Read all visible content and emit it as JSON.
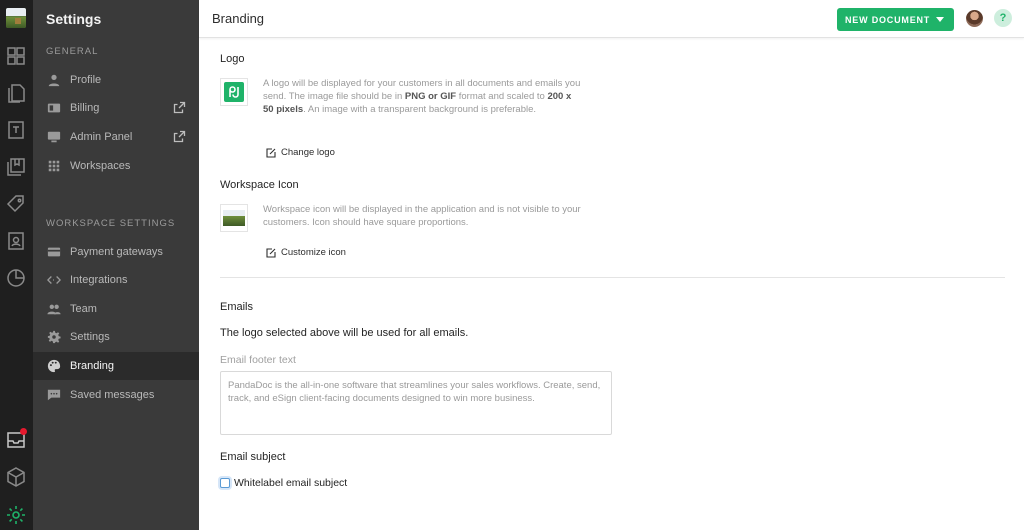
{
  "sidebar": {
    "title": "Settings",
    "general_heading": "GENERAL",
    "workspace_heading": "WORKSPACE SETTINGS",
    "general_items": [
      {
        "label": "Profile",
        "icon": "person-icon"
      },
      {
        "label": "Billing",
        "icon": "billing-icon"
      },
      {
        "label": "Admin Panel",
        "icon": "monitor-icon"
      },
      {
        "label": "Workspaces",
        "icon": "grid-icon"
      }
    ],
    "workspace_items": [
      {
        "label": "Payment gateways",
        "icon": "card-icon"
      },
      {
        "label": "Integrations",
        "icon": "code-arrows-icon"
      },
      {
        "label": "Team",
        "icon": "team-icon"
      },
      {
        "label": "Settings",
        "icon": "gear-icon"
      },
      {
        "label": "Branding",
        "icon": "palette-icon"
      },
      {
        "label": "Saved messages",
        "icon": "chat-icon"
      }
    ]
  },
  "header": {
    "title": "Branding",
    "new_document_label": "NEW DOCUMENT",
    "help_label": "?"
  },
  "logo": {
    "heading": "Logo",
    "description_1": "A logo will be displayed for your customers in all documents and emails you send. The image file should be in ",
    "format": "PNG or GIF",
    "description_2": " format and scaled to ",
    "size": "200 x 50 pixels",
    "description_3": ". An image with a transparent background is preferable.",
    "action_label": "Change logo"
  },
  "workspace_icon": {
    "heading": "Workspace Icon",
    "description": "Workspace icon will be displayed in the application and is not visible to your customers. Icon should have square proportions.",
    "action_label": "Customize icon"
  },
  "emails": {
    "heading": "Emails",
    "note": "The logo selected above will be used for all emails.",
    "footer_label": "Email footer text",
    "footer_placeholder": "PandaDoc is the all-in-one software that streamlines your sales workflows. Create, send, track, and eSign client-facing documents designed to win more business.",
    "subject_heading": "Email subject",
    "whitelabel_label": "Whitelabel email subject"
  },
  "colors": {
    "accent": "#1fb369",
    "sidebar_bg": "#3a3a3a",
    "rail_bg": "#1f1f1f"
  }
}
